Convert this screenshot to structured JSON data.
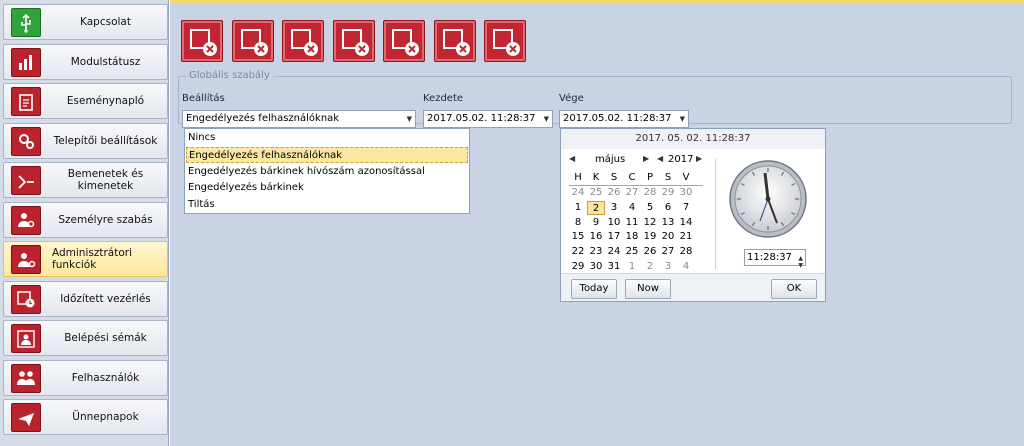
{
  "sidebar": {
    "items": [
      {
        "label": "Kapcsolat",
        "icon": "usb-icon"
      },
      {
        "label": "Modulstátusz",
        "icon": "bar-chart-icon"
      },
      {
        "label": "Eseménynapló",
        "icon": "clipboard-icon"
      },
      {
        "label": "Telepítői beállítások",
        "icon": "gears-icon"
      },
      {
        "label": "Bemenetek és kimenetek",
        "icon": "io-icon"
      },
      {
        "label": "Személyre szabás",
        "icon": "person-settings-icon"
      },
      {
        "label": "Adminisztrátori funkciók",
        "icon": "admin-icon"
      },
      {
        "label": "Időzített vezérlés",
        "icon": "calendar-clock-icon"
      },
      {
        "label": "Belépési sémák",
        "icon": "entry-schema-icon"
      },
      {
        "label": "Felhasználók",
        "icon": "users-icon"
      },
      {
        "label": "Ünnepnapok",
        "icon": "holiday-plane-icon"
      }
    ],
    "active_index": 6
  },
  "toolbar": {
    "buttons": [
      {
        "name": "download-settings-icon"
      },
      {
        "name": "upload-settings-icon"
      },
      {
        "name": "clear-timer-icon"
      },
      {
        "name": "clear-output-icon"
      },
      {
        "name": "clear-users-icon"
      },
      {
        "name": "clear-signal-icon"
      },
      {
        "name": "clear-device-icon"
      }
    ]
  },
  "global_rule": {
    "group_title": "Globális szabály",
    "setting_label": "Beállítás",
    "setting_value": "Engedélyezés felhasználóknak",
    "start_label": "Kezdete",
    "start_value": "2017.05.02. 11:28:37",
    "end_label": "Vége",
    "end_value": "2017.05.02. 11:28:37"
  },
  "dropdown": {
    "options": [
      "Nincs",
      "Engedélyezés felhasználóknak",
      "Engedélyezés bárkinek hívószám azonosítással",
      "Engedélyezés bárkinek",
      "Tiltás"
    ],
    "selected_index": 1
  },
  "calendar": {
    "header": "2017. 05. 02. 11:28:37",
    "month": "május",
    "year": "2017",
    "weekdays": [
      "H",
      "K",
      "S",
      "C",
      "P",
      "S",
      "V"
    ],
    "weeks": [
      [
        "24",
        "25",
        "26",
        "27",
        "28",
        "29",
        "30"
      ],
      [
        "1",
        "2",
        "3",
        "4",
        "5",
        "6",
        "7"
      ],
      [
        "8",
        "9",
        "10",
        "11",
        "12",
        "13",
        "14"
      ],
      [
        "15",
        "16",
        "17",
        "18",
        "19",
        "20",
        "21"
      ],
      [
        "22",
        "23",
        "24",
        "25",
        "26",
        "27",
        "28"
      ],
      [
        "29",
        "30",
        "31",
        "1",
        "2",
        "3",
        "4"
      ]
    ],
    "selected_day": "2",
    "time": "11:28:37",
    "today_label": "Today",
    "now_label": "Now",
    "ok_label": "OK"
  },
  "colors": {
    "accent_red": "#c22633",
    "sidebar_bg": "#d5dce8",
    "main_bg": "#c9d3e3",
    "active_item": "#fde89a"
  }
}
